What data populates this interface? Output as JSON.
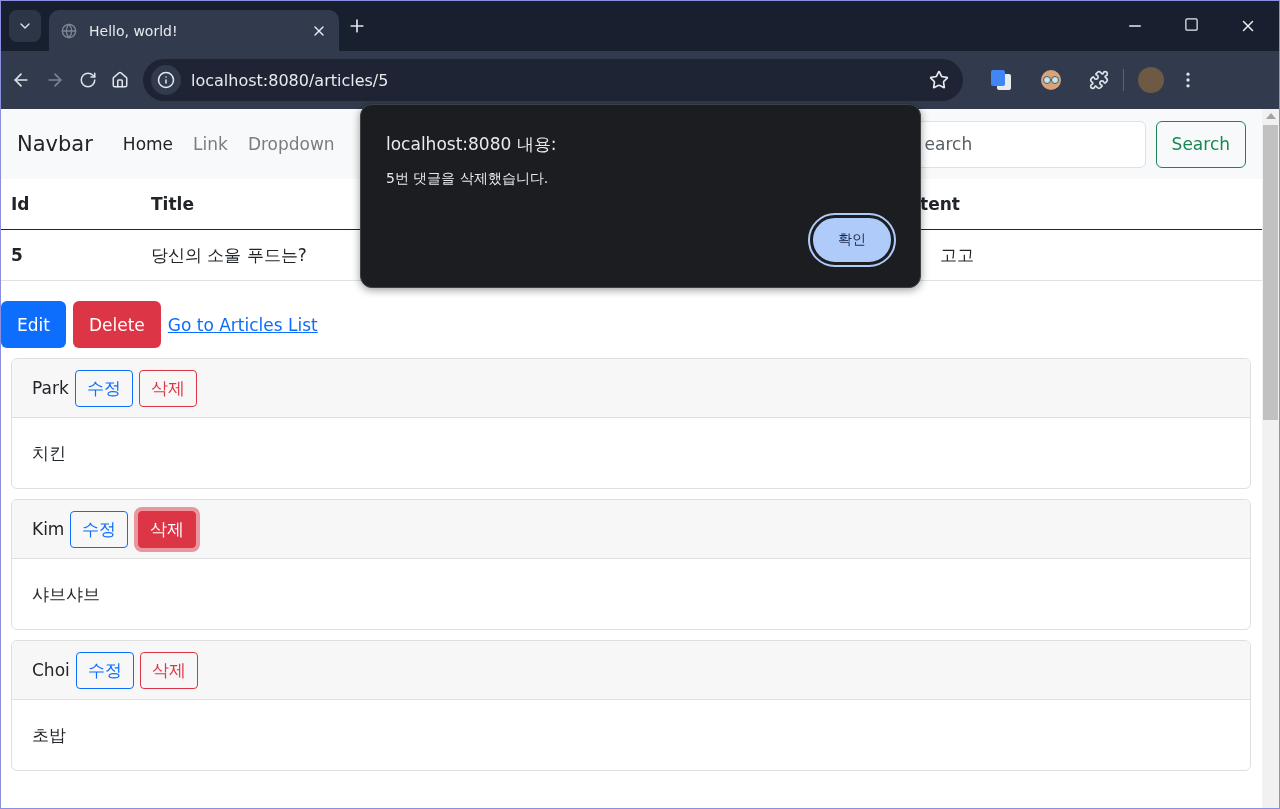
{
  "browser": {
    "tab_title": "Hello, world!",
    "url": "localhost:8080/articles/5"
  },
  "navbar": {
    "brand": "Navbar",
    "links": [
      {
        "label": "Home",
        "selected": true
      },
      {
        "label": "Link",
        "selected": false
      },
      {
        "label": "Dropdown",
        "selected": false
      }
    ],
    "search_placeholder": "earch",
    "search_button": "Search"
  },
  "table": {
    "columns": [
      "Id",
      "Title",
      "tent"
    ],
    "rows": [
      [
        "5",
        "당신의 소울 푸드는?",
        "고고"
      ]
    ]
  },
  "actions": {
    "edit": "Edit",
    "delete": "Delete",
    "link": "Go to Articles List"
  },
  "comments": [
    {
      "author": "Park",
      "edit": "수정",
      "delete": "삭제",
      "delete_focused": false,
      "body": "치킨"
    },
    {
      "author": "Kim",
      "edit": "수정",
      "delete": "삭제",
      "delete_focused": true,
      "body": "샤브샤브"
    },
    {
      "author": "Choi",
      "edit": "수정",
      "delete": "삭제",
      "delete_focused": false,
      "body": "초밥"
    }
  ],
  "dialog": {
    "title": "localhost:8080 내용:",
    "message": "5번 댓글을 삭제했습니다.",
    "button": "확인"
  }
}
